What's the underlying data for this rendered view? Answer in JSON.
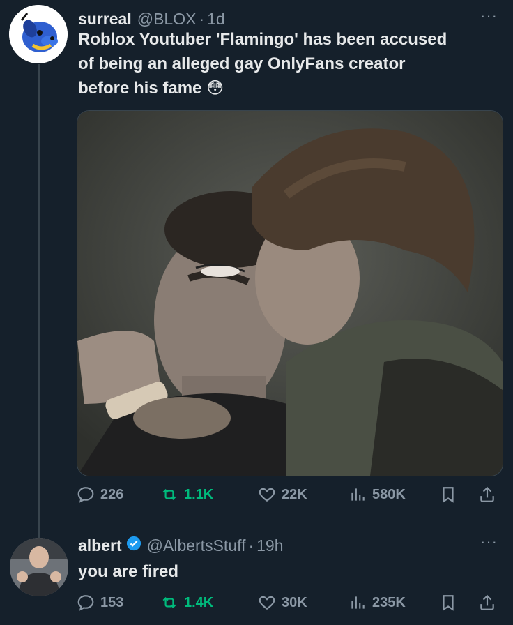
{
  "tweet": {
    "display_name": "surreal",
    "handle": "@BLOX",
    "separator": "·",
    "time": "1d",
    "more": "···",
    "text_line1": "Roblox Youtuber 'Flamingo' has been accused",
    "text_line2": "of being an alleged gay OnlyFans creator",
    "text_line3": "before his fame",
    "emoji": "😳",
    "stats": {
      "replies": "226",
      "reposts": "1.1K",
      "likes": "22K",
      "views": "580K"
    }
  },
  "reply": {
    "display_name": "albert",
    "handle": "@AlbertsStuff",
    "separator": "·",
    "time": "19h",
    "more": "···",
    "text": "you are fired",
    "stats": {
      "replies": "153",
      "reposts": "1.4K",
      "likes": "30K",
      "views": "235K"
    }
  },
  "colors": {
    "background": "#15202b",
    "text": "#e7e9ea",
    "muted": "#8b98a5",
    "repost": "#00ba7c",
    "verified": "#1d9bf0"
  }
}
